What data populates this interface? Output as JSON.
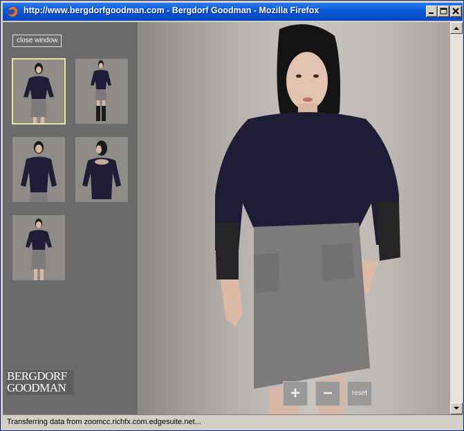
{
  "window": {
    "title": "http://www.bergdorfgoodman.com - Bergdorf Goodman - Mozilla Firefox"
  },
  "sidebar": {
    "close_label": "close window",
    "thumbnails": [
      {
        "pose": "front",
        "selected": true
      },
      {
        "pose": "full-length with boots",
        "selected": false
      },
      {
        "pose": "front close",
        "selected": false
      },
      {
        "pose": "back",
        "selected": false
      },
      {
        "pose": "front hands on hips",
        "selected": false
      }
    ],
    "logo": {
      "line1": "BERGDORF",
      "line2": "GOODMAN"
    }
  },
  "zoom": {
    "plus_label": "+",
    "minus_label": "−",
    "reset_label": "reset"
  },
  "status": {
    "text": "Transferring data from zoomcc.richfx.com.edgesuite.net..."
  },
  "colors": {
    "titlebar": "#0a58d4",
    "panel": "#6b6b6b",
    "thumb_selected_border": "#e6e6a0",
    "top": "#1e1d35",
    "skirt": "#7c7a7b"
  }
}
